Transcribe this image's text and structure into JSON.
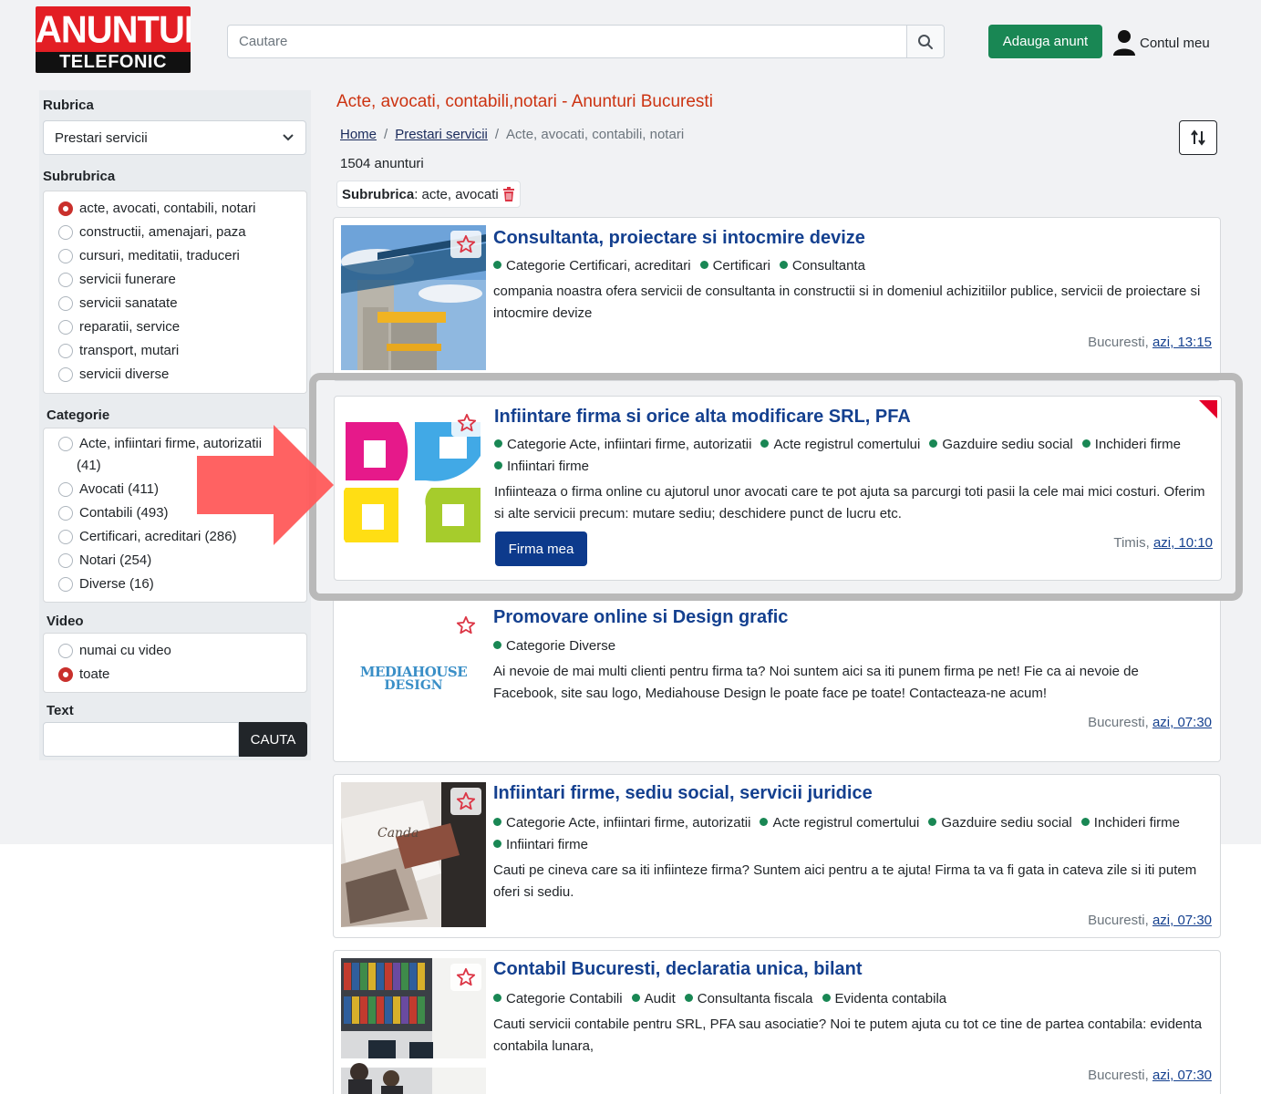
{
  "header": {
    "logo_top": "ANUNTUL",
    "logo_bottom": "TELEFONIC",
    "search_placeholder": "Cautare",
    "add_button": "Adauga anunt",
    "account": "Contul meu"
  },
  "sidebar": {
    "rubrica_label": "Rubrica",
    "rubrica_value": "Prestari servicii",
    "subrubrica_label": "Subrubrica",
    "subrubrici": [
      "acte, avocati, contabili, notari",
      "constructii, amenajari, paza",
      "cursuri, meditatii, traduceri",
      "servicii funerare",
      "servicii sanatate",
      "reparatii, service",
      "transport, mutari",
      "servicii diverse"
    ],
    "categorie_label": "Categorie",
    "categorii": [
      "Acte, infiintari firme, autorizatii",
      "(41)",
      "Avocati (411)",
      "Contabili (493)",
      "Certificari, acreditari (286)",
      "Notari (254)",
      "Diverse (16)"
    ],
    "video_label": "Video",
    "video_options": [
      "numai cu video",
      "toate"
    ],
    "text_label": "Text",
    "search_button": "CAUTA"
  },
  "main": {
    "title": "Acte, avocati, contabili,notari - Anunturi Bucuresti",
    "breadcrumb": [
      "Home",
      "/",
      "Prestari servicii",
      "/",
      "Acte, avocati, contabili, notari"
    ],
    "count": "1504 anunturi",
    "filter_key": "Subrubrica",
    "filter_value": ": acte, avocati"
  },
  "listings": [
    {
      "title": "Consultanta, proiectare si intocmire devize",
      "tags": [
        "Categorie Certificari, acreditari",
        "Certificari",
        "Consultanta"
      ],
      "desc": "compania noastra ofera servicii de consultanta in constructii si in domeniul achizitiilor publice, servicii de proiectare si intocmire devize",
      "location": "Bucuresti,",
      "time": "azi, 13:15"
    },
    {
      "title": "Infiintare firma si orice alta modificare SRL, PFA",
      "tags": [
        "Categorie Acte, infiintari firme, autorizatii",
        "Acte registrul comertului",
        "Gazduire sediu social",
        "Inchideri firme",
        "Infiintari firme"
      ],
      "desc": "Infiinteaza o firma online cu ajutorul unor avocati care te pot ajuta sa parcurgi toti pasii la cele mai mici costuri. Oferim si alte servicii precum: mutare sediu; deschidere punct de lucru etc.",
      "button": "Firma mea",
      "location": "Timis,",
      "time": "azi, 10:10"
    },
    {
      "title": "Promovare online si Design grafic",
      "tags": [
        "Categorie Diverse"
      ],
      "desc": "Ai nevoie de mai multi clienti pentru firma ta? Noi suntem aici sa iti punem firma pe net! Fie ca ai nevoie de Facebook, site sau logo, Mediahouse Design le poate face pe toate! Contacteaza-ne acum!",
      "logo_text_1": "MEDIAHOUSE",
      "logo_text_2": "DESIGN",
      "location": "Bucuresti,",
      "time": "azi, 07:30"
    },
    {
      "title": "Infiintari firme, sediu social, servicii juridice",
      "tags": [
        "Categorie Acte, infiintari firme, autorizatii",
        "Acte registrul comertului",
        "Gazduire sediu social",
        "Inchideri firme",
        "Infiintari firme"
      ],
      "desc": "Cauti pe cineva care sa iti infiinteze firma? Suntem aici pentru a te ajuta! Firma ta va fi gata in cateva zile si iti putem oferi si sediu.",
      "location": "Bucuresti,",
      "time": "azi, 07:30"
    },
    {
      "title": "Contabil Bucuresti, declaratia unica, bilant",
      "tags": [
        "Categorie Contabili",
        "Audit",
        "Consultanta fiscala",
        "Evidenta contabila"
      ],
      "desc": "Cauti servicii contabile pentru SRL, PFA sau asociatie? Noi te putem ajuta cu tot ce tine de partea contabila: evidenta contabila lunara,",
      "location": "Bucuresti,",
      "time": "azi, 07:30"
    }
  ],
  "colors": {
    "brand_red": "#e31e24",
    "title_blue": "#14408f",
    "green": "#198754",
    "highlight_gray": "#b9b9b9",
    "arrow_red": "#ff5a5a"
  }
}
